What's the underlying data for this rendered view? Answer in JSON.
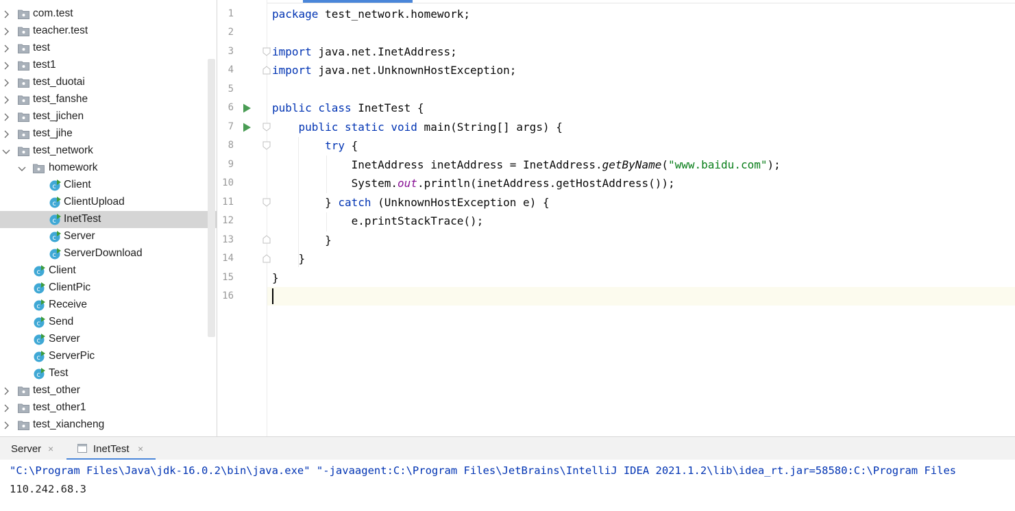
{
  "project_tree": {
    "items": [
      {
        "label": "com.test",
        "type": "package",
        "expanded": false
      },
      {
        "label": "teacher.test",
        "type": "package",
        "expanded": false
      },
      {
        "label": "test",
        "type": "package",
        "expanded": false
      },
      {
        "label": "test1",
        "type": "package",
        "expanded": false
      },
      {
        "label": "test_duotai",
        "type": "package",
        "expanded": false
      },
      {
        "label": "test_fanshe",
        "type": "package",
        "expanded": false
      },
      {
        "label": "test_jichen",
        "type": "package",
        "expanded": false
      },
      {
        "label": "test_jihe",
        "type": "package",
        "expanded": false
      },
      {
        "label": "test_network",
        "type": "package",
        "expanded": true
      },
      {
        "label": "homework",
        "type": "package",
        "expanded": true
      },
      {
        "label": "Client",
        "type": "class"
      },
      {
        "label": "ClientUpload",
        "type": "class"
      },
      {
        "label": "InetTest",
        "type": "class",
        "selected": true
      },
      {
        "label": "Server",
        "type": "class"
      },
      {
        "label": "ServerDownload",
        "type": "class"
      },
      {
        "label": "Client",
        "type": "class"
      },
      {
        "label": "ClientPic",
        "type": "class"
      },
      {
        "label": "Receive",
        "type": "class"
      },
      {
        "label": "Send",
        "type": "class"
      },
      {
        "label": "Server",
        "type": "class"
      },
      {
        "label": "ServerPic",
        "type": "class"
      },
      {
        "label": "Test",
        "type": "class"
      },
      {
        "label": "test_other",
        "type": "package",
        "expanded": false
      },
      {
        "label": "test_other1",
        "type": "package",
        "expanded": false
      },
      {
        "label": "test_xiancheng",
        "type": "package",
        "expanded": false
      }
    ]
  },
  "editor": {
    "line_numbers": [
      "1",
      "2",
      "3",
      "4",
      "5",
      "6",
      "7",
      "8",
      "9",
      "10",
      "11",
      "12",
      "13",
      "14",
      "15",
      "16"
    ],
    "lines": [
      {
        "kw": "package",
        "rest": " test_network.homework;"
      },
      {},
      {
        "kw": "import",
        "rest": " java.net.InetAddress;"
      },
      {
        "kw": "import",
        "rest": " java.net.UnknownHostException;"
      },
      {},
      {
        "kw": "public class",
        "rest": " InetTest {"
      },
      {
        "indent": "    ",
        "kw": "public static void",
        "rest": " main(String[] args) {"
      },
      {
        "indent": "        ",
        "kw": "try",
        "rest": " {"
      },
      {
        "indent": "            ",
        "a": "InetAddress inetAddress = InetAddress.",
        "italic": "getByName",
        "b": "(",
        "str": "\"www.baidu.com\"",
        "c": ");"
      },
      {
        "indent": "            ",
        "a": "System.",
        "static": "out",
        "b": ".println(inetAddress.getHostAddress());"
      },
      {
        "indent": "        ",
        "a": "} ",
        "kw": "catch",
        "rest": " (UnknownHostException e) {"
      },
      {
        "indent": "            ",
        "a": "e.printStackTrace();"
      },
      {
        "indent": "        ",
        "a": "}"
      },
      {
        "indent": "    ",
        "a": "}"
      },
      {
        "a": "}"
      },
      {}
    ],
    "colors": {
      "keyword": "#0033b3",
      "string": "#067d17",
      "static_field": "#871094",
      "run_icon": "#499c54"
    }
  },
  "run_panel": {
    "tabs": [
      {
        "label": "Server",
        "close": "×"
      },
      {
        "label": "InetTest",
        "close": "×",
        "active": true
      }
    ],
    "console": {
      "command": "\"C:\\Program Files\\Java\\jdk-16.0.2\\bin\\java.exe\" \"-javaagent:C:\\Program Files\\JetBrains\\IntelliJ IDEA 2021.1.2\\lib\\idea_rt.jar=58580:C:\\Program Files",
      "output": "110.242.68.3"
    }
  }
}
